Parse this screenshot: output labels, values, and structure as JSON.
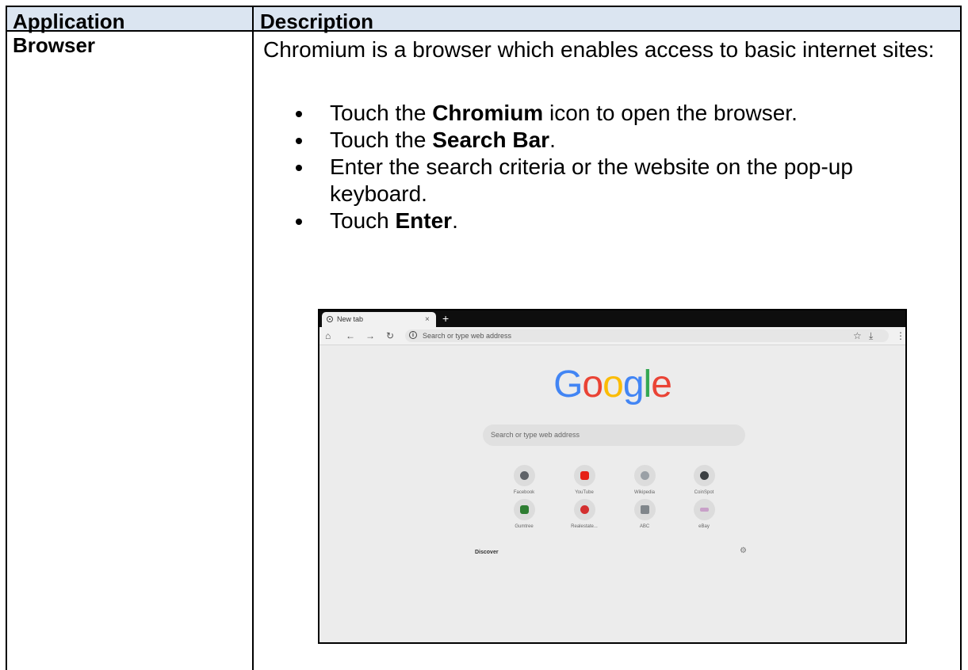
{
  "table": {
    "headers": [
      "Application",
      "Description"
    ],
    "row": {
      "application": "Browser",
      "intro": "Chromium is a browser which enables access to basic internet sites:",
      "bullets": [
        {
          "pre": "Touch the ",
          "bold": "Chromium",
          "post": " icon to open the browser."
        },
        {
          "pre": "Touch the ",
          "bold": "Search Bar",
          "post": "."
        },
        {
          "pre": "Enter the search criteria or the website on the pop-up keyboard.",
          "bold": "",
          "post": ""
        },
        {
          "pre": "Touch ",
          "bold": "Enter",
          "post": "."
        }
      ]
    }
  },
  "screenshot": {
    "tab_title": "New tab",
    "tab_close": "×",
    "new_tab": "+",
    "omnibox_info": "i",
    "omnibox_placeholder": "Search or type web address",
    "logo_letters": [
      {
        "ch": "G",
        "color": "#4285f4"
      },
      {
        "ch": "o",
        "color": "#ea4335"
      },
      {
        "ch": "o",
        "color": "#fbbc05"
      },
      {
        "ch": "g",
        "color": "#4285f4"
      },
      {
        "ch": "l",
        "color": "#34a853"
      },
      {
        "ch": "e",
        "color": "#ea4335"
      }
    ],
    "search_placeholder": "Search or type web address",
    "tiles": [
      {
        "label": "Facebook",
        "color": "#5f6368"
      },
      {
        "label": "YouTube",
        "color": "#e62117"
      },
      {
        "label": "Wikipedia",
        "color": "#9aa0a6"
      },
      {
        "label": "CoinSpot",
        "color": "#3c4043"
      },
      {
        "label": "Gumtree",
        "color": "#2e7d32"
      },
      {
        "label": "Realestate...",
        "color": "#d32f2f"
      },
      {
        "label": "ABC",
        "color": "#80868b"
      },
      {
        "label": "eBay",
        "color": "#c8a0c8"
      }
    ],
    "discover": "Discover"
  }
}
